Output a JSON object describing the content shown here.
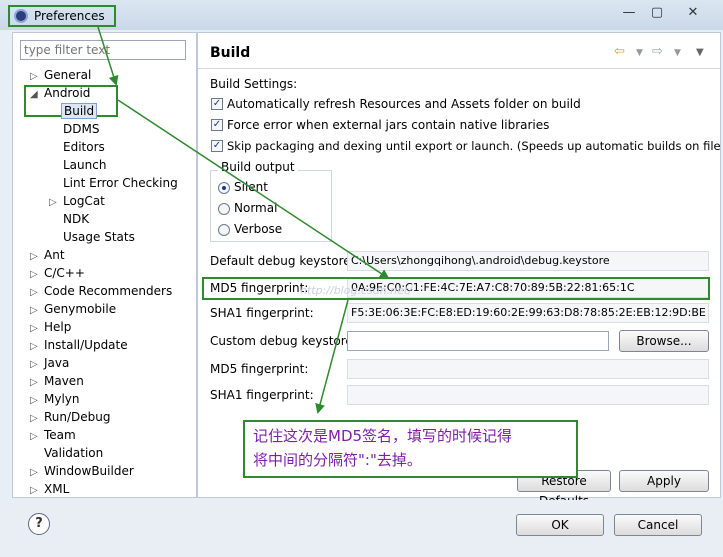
{
  "window": {
    "title": "Preferences"
  },
  "filter": {
    "placeholder": "type filter text"
  },
  "tree": {
    "general": "General",
    "android": "Android",
    "android_children": [
      "Build",
      "DDMS",
      "Editors",
      "Launch",
      "Lint Error Checking",
      "LogCat",
      "NDK",
      "Usage Stats"
    ],
    "others": [
      "Ant",
      "C/C++",
      "Code Recommenders",
      "Genymobile",
      "Help",
      "Install/Update",
      "Java",
      "Maven",
      "Mylyn",
      "Run/Debug",
      "Team",
      "Validation",
      "WindowBuilder",
      "XML"
    ]
  },
  "page": {
    "title": "Build",
    "settings_label": "Build Settings:",
    "checkboxes": [
      {
        "label": "Automatically refresh Resources and Assets folder on build",
        "checked": true
      },
      {
        "label": "Force error when external jars contain native libraries",
        "checked": true
      },
      {
        "label": "Skip packaging and dexing until export or launch. (Speeds up automatic builds on file save)",
        "checked": true
      }
    ],
    "build_output": {
      "title": "Build output",
      "options": [
        "Silent",
        "Normal",
        "Verbose"
      ],
      "selected": "Silent"
    },
    "default_keystore_label": "Default debug keystore:",
    "default_keystore_value": "C:\\Users\\zhongqihong\\.android\\debug.keystore",
    "md5_label": "MD5 fingerprint:",
    "md5_value": "0A:9E:C0:C1:FE:4C:7E:A7:C8:70:89:5B:22:81:65:1C",
    "sha1_label": "SHA1 fingerprint:",
    "sha1_value": "F5:3E:06:3E:FC:E8:ED:19:60:2E:99:63:D8:78:85:2E:EB:12:9D:BE",
    "custom_keystore_label": "Custom debug keystore:",
    "custom_keystore_value": "",
    "custom_md5_label": "MD5 fingerprint:",
    "custom_sha1_label": "SHA1 fingerprint:",
    "browse_label": "Browse...",
    "restore_label": "Restore Defaults",
    "apply_label": "Apply"
  },
  "watermark": "http://blog.csdn.net/",
  "annotation": {
    "line1": "记住这次是MD5签名，填写的时候记得",
    "line2": "将中间的分隔符\":\"去掉。"
  },
  "footer": {
    "ok_label": "OK",
    "cancel_label": "Cancel",
    "help_symbol": "?"
  },
  "colors": {
    "highlight_box": "#2f8a2f",
    "annotation_text": "#7e1fa8",
    "selection": "#dbe7f7"
  }
}
